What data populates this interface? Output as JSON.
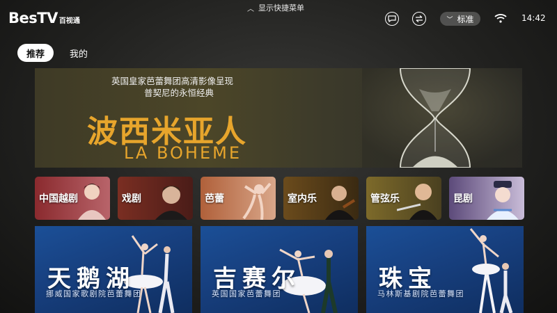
{
  "app": {
    "logo_main": "BesTV",
    "logo_sub": "百视通"
  },
  "topbar": {
    "quick_menu": "显示快捷菜单",
    "quality": "标准",
    "time": "14:42",
    "icons": [
      "message-icon",
      "switch-icon",
      "wifi-icon"
    ]
  },
  "tabs": [
    {
      "label": "推荐",
      "active": true
    },
    {
      "label": "我的",
      "active": false
    }
  ],
  "banner": {
    "subtitle_line1": "英国皇家芭蕾舞团高清影像呈现",
    "subtitle_line2": "普契尼的永恒经典",
    "title": "波西米亚人",
    "title_en": "LA BOHEME",
    "accent": "#e7a52c"
  },
  "categories": [
    {
      "label": "中国越剧",
      "bg": "#8a2a2e"
    },
    {
      "label": "戏剧",
      "bg": "#7a2e22"
    },
    {
      "label": "芭蕾",
      "bg": "#b0603a"
    },
    {
      "label": "室内乐",
      "bg": "#6b4b1c"
    },
    {
      "label": "管弦乐",
      "bg": "#7d6a2a"
    },
    {
      "label": "昆剧",
      "bg": "#5c4a7a"
    }
  ],
  "cards": [
    {
      "title": "天鹅湖",
      "subtitle": "挪威国家歌剧院芭蕾舞团"
    },
    {
      "title": "吉赛尔",
      "subtitle": "英国国家芭蕾舞团"
    },
    {
      "title": "珠宝",
      "subtitle": "马林斯基剧院芭蕾舞团"
    }
  ]
}
